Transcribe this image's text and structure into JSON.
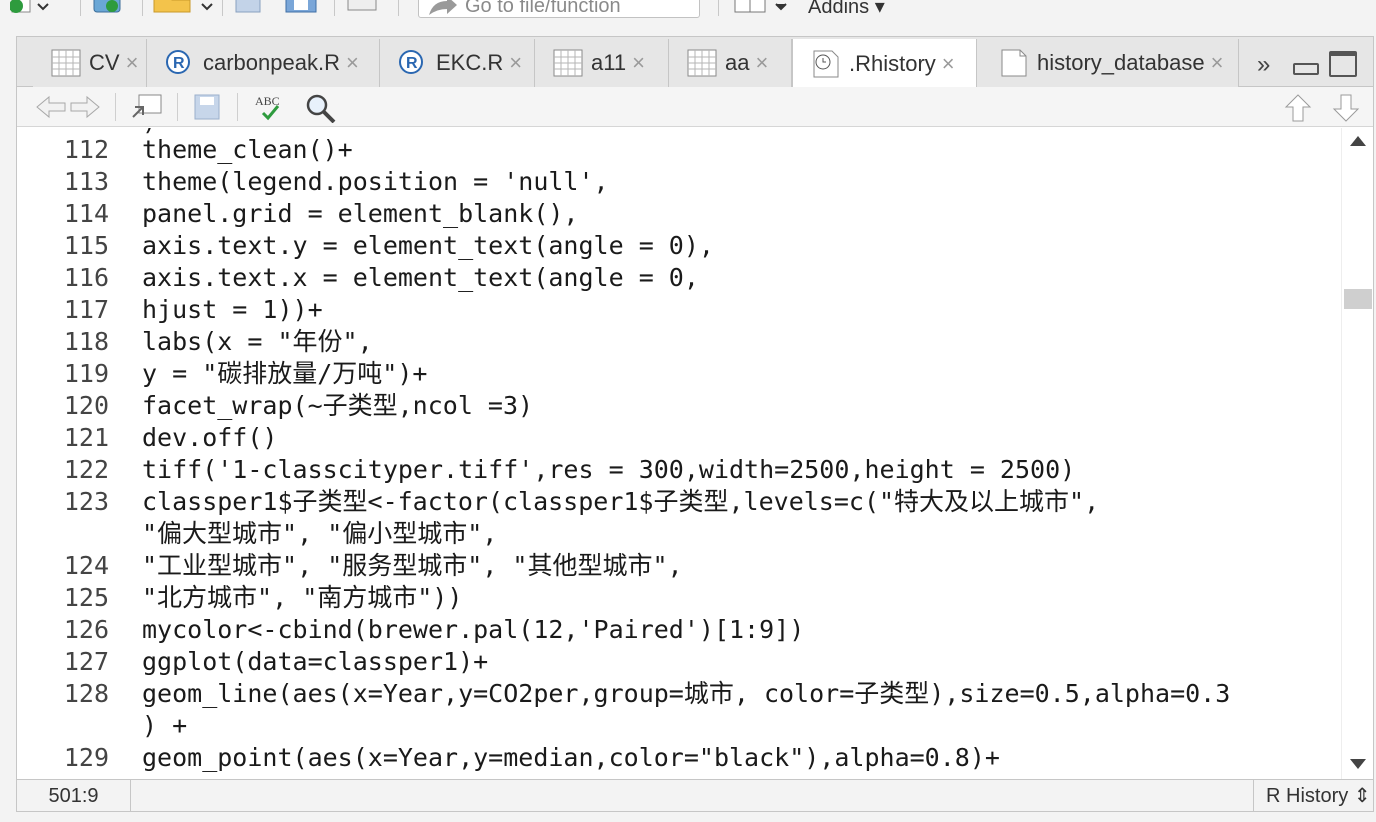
{
  "toolbar": {
    "goto_placeholder": "Go to file/function",
    "addins_label": "Addins"
  },
  "tabs": [
    {
      "label": "CV",
      "icon": "table-icon",
      "close": "×",
      "active": false
    },
    {
      "label": "carbonpeak.R",
      "icon": "r-file-icon",
      "close": "×",
      "active": false
    },
    {
      "label": "EKC.R",
      "icon": "r-file-icon",
      "close": "×",
      "active": false
    },
    {
      "label": "a11",
      "icon": "table-icon",
      "close": "×",
      "active": false
    },
    {
      "label": "aa",
      "icon": "table-icon",
      "close": "×",
      "active": false
    },
    {
      "label": ".Rhistory",
      "icon": "history-icon",
      "close": "×",
      "active": true
    },
    {
      "label": "history_database",
      "icon": "file-icon",
      "close": "×",
      "active": false
    }
  ],
  "tab_more": "»",
  "code_lines": [
    {
      "num": "",
      "text": ")"
    },
    {
      "num": "112",
      "text": "theme_clean()+"
    },
    {
      "num": "113",
      "text": "theme(legend.position = 'null',"
    },
    {
      "num": "114",
      "text": "panel.grid = element_blank(),"
    },
    {
      "num": "115",
      "text": "axis.text.y = element_text(angle = 0),"
    },
    {
      "num": "116",
      "text": "axis.text.x = element_text(angle = 0,"
    },
    {
      "num": "117",
      "text": "hjust = 1))+"
    },
    {
      "num": "118",
      "text": "labs(x = \"年份\","
    },
    {
      "num": "119",
      "text": "y = \"碳排放量/万吨\")+"
    },
    {
      "num": "120",
      "text": "facet_wrap(~子类型,ncol =3)"
    },
    {
      "num": "121",
      "text": "dev.off()"
    },
    {
      "num": "122",
      "text": "tiff('1-classcityper.tiff',res = 300,width=2500,height = 2500)"
    },
    {
      "num": "123",
      "text": "classper1$子类型<-factor(classper1$子类型,levels=c(\"特大及以上城市\","
    },
    {
      "num": "",
      "text": "\"偏大型城市\", \"偏小型城市\","
    },
    {
      "num": "124",
      "text": "\"工业型城市\", \"服务型城市\", \"其他型城市\","
    },
    {
      "num": "125",
      "text": "\"北方城市\", \"南方城市\"))"
    },
    {
      "num": "126",
      "text": "mycolor<-cbind(brewer.pal(12,'Paired')[1:9])"
    },
    {
      "num": "127",
      "text": "ggplot(data=classper1)+"
    },
    {
      "num": "128",
      "text": "geom_line(aes(x=Year,y=CO2per,group=城市, color=子类型),size=0.5,alpha=0.3"
    },
    {
      "num": "",
      "text": ") +"
    },
    {
      "num": "129",
      "text": "geom_point(aes(x=Year,y=median,color=\"black\"),alpha=0.8)+"
    }
  ],
  "status": {
    "cursor_position": "501:9",
    "file_type": "R History ⇕"
  }
}
